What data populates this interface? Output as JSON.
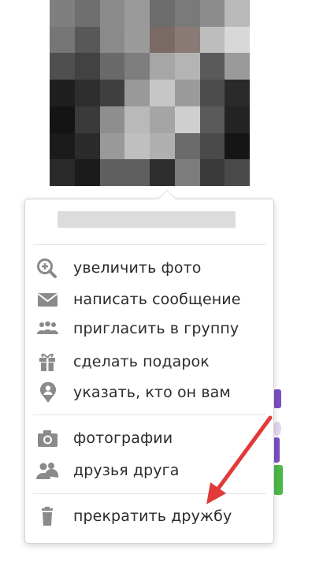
{
  "profile_photo": {
    "description": "pixelated profile photo",
    "pixels": [
      [
        "#7f7f7f",
        "#6f6f6f",
        "#8a8a8a",
        "#9a9a9a",
        "#6c6c6c",
        "#7a7a7a",
        "#8c8c8c",
        "#b9b9b9"
      ],
      [
        "#767676",
        "#585858",
        "#8a8a8a",
        "#9b9b9b",
        "#7a6a66",
        "#8b7b77",
        "#bdbdbd",
        "#d8d8d8"
      ],
      [
        "#4f4f4f",
        "#424242",
        "#6a6a6a",
        "#7e7e7e",
        "#a6a6a6",
        "#b4b4b4",
        "#5a5a5a",
        "#9a9a9a"
      ],
      [
        "#1f1f1f",
        "#2e2e2e",
        "#3f3f3f",
        "#999999",
        "#c6c6c6",
        "#9b9b9b",
        "#4c4c4c",
        "#2a2a2a"
      ],
      [
        "#141414",
        "#3a3a3a",
        "#8e8e8e",
        "#b9b9b9",
        "#a5a5a5",
        "#cfcfcf",
        "#5a5a5a",
        "#242424"
      ],
      [
        "#1a1a1a",
        "#2b2b2b",
        "#999999",
        "#bfbfbf",
        "#b0b0b0",
        "#6b6b6b",
        "#4a4a4a",
        "#161616"
      ],
      [
        "#2a2a2a",
        "#1b1b1b",
        "#5f5f5f",
        "#5e5e5e",
        "#2d2d2d",
        "#7c7c7c",
        "#3a3a3a",
        "#4a4a4a"
      ]
    ]
  },
  "menu": {
    "user_name_redacted": "",
    "section_actions": [
      {
        "icon": "zoom-in-icon",
        "label": "увеличить фото"
      },
      {
        "icon": "envelope-icon",
        "label": "написать сообщение"
      },
      {
        "icon": "group-invite-icon",
        "label": "пригласить в группу"
      },
      {
        "icon": "gift-icon",
        "label": "сделать подарок"
      },
      {
        "icon": "person-pin-icon",
        "label": "указать, кто он вам"
      }
    ],
    "section_navigation": [
      {
        "icon": "camera-icon",
        "label": "фотографии"
      },
      {
        "icon": "friends-icon",
        "label": "друзья друга"
      }
    ],
    "section_danger": [
      {
        "icon": "trash-icon",
        "label": "прекратить дружбу"
      }
    ]
  },
  "annotation": {
    "type": "red-arrow",
    "points_to": "прекратить дружбу",
    "color": "#e03a3a"
  },
  "colors": {
    "icon": "#8a8a8a",
    "text": "#2b2b2b",
    "divider": "#e2e2e2"
  }
}
